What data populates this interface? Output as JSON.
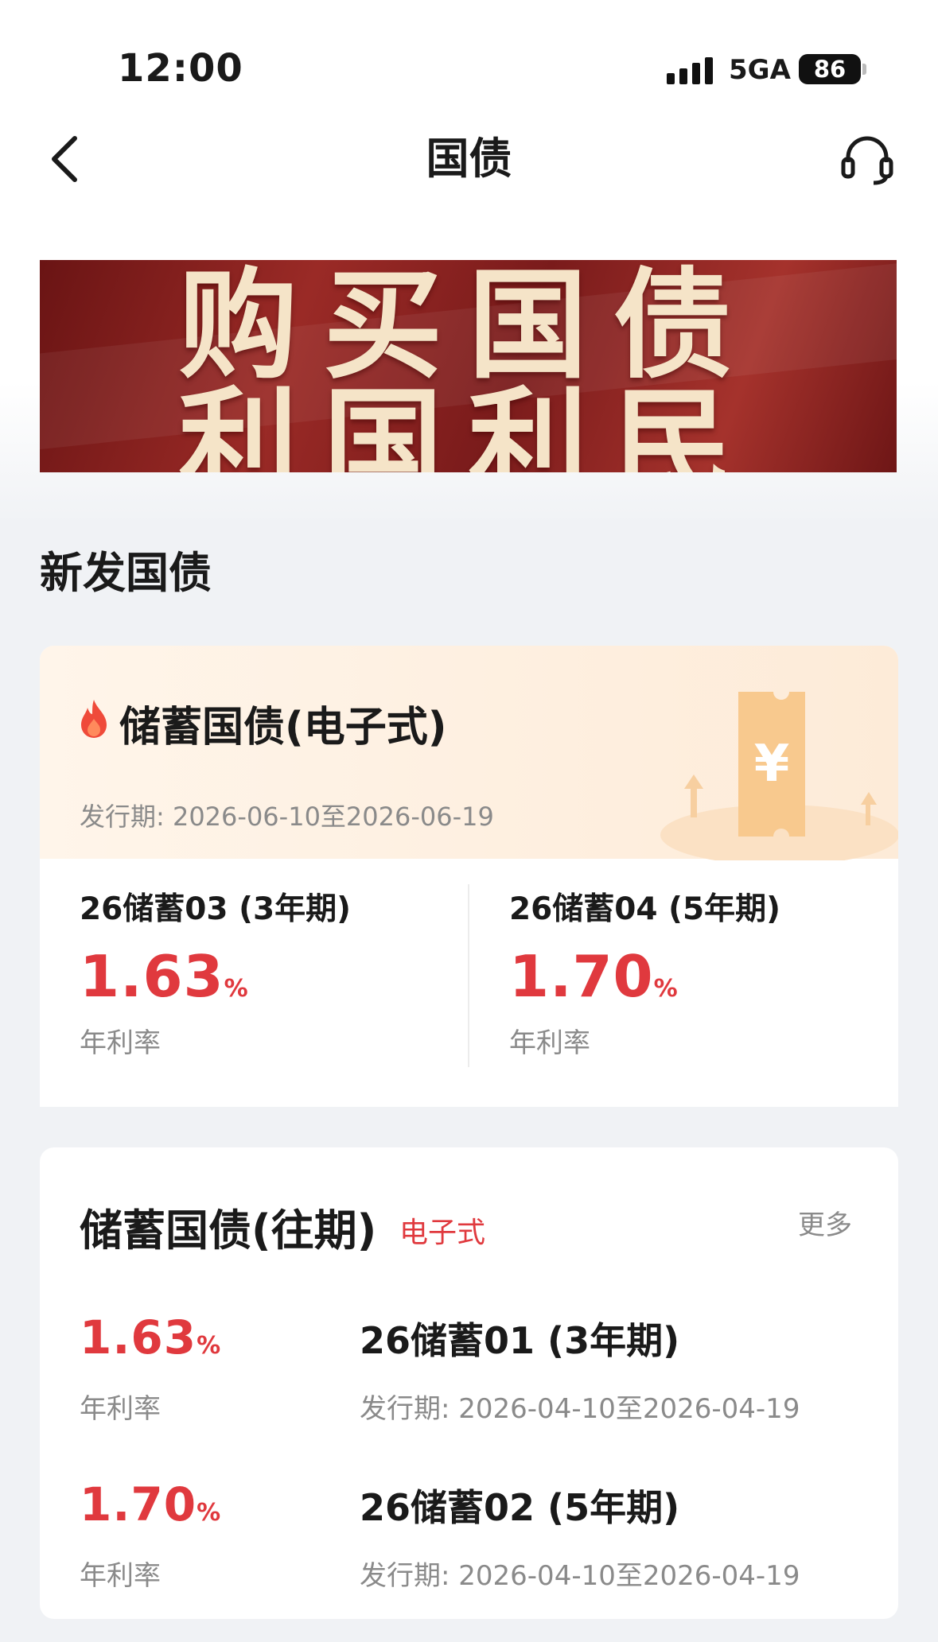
{
  "status_bar": {
    "time": "12:00",
    "network": "5GA",
    "battery": "86"
  },
  "nav": {
    "title": "国债"
  },
  "banner": {
    "line1": "购买国债",
    "line2": "利国利民"
  },
  "section_title": "新发国债",
  "new_issue": {
    "title": "储蓄国债(电子式)",
    "period": "发行期: 2026-06-10至2026-06-19",
    "bonds": [
      {
        "name": "26储蓄03 (3年期)",
        "rate": "1.63",
        "unit": "%",
        "rate_label": "年利率"
      },
      {
        "name": "26储蓄04 (5年期)",
        "rate": "1.70",
        "unit": "%",
        "rate_label": "年利率"
      }
    ]
  },
  "past": {
    "title": "储蓄国债(往期)",
    "tag": "电子式",
    "more": "更多",
    "items": [
      {
        "rate": "1.63",
        "unit": "%",
        "rate_label": "年利率",
        "name": "26储蓄01 (3年期)",
        "period": "发行期: 2026-04-10至2026-04-19"
      },
      {
        "rate": "1.70",
        "unit": "%",
        "rate_label": "年利率",
        "name": "26储蓄02 (5年期)",
        "period": "发行期: 2026-04-10至2026-04-19"
      }
    ]
  },
  "colors": {
    "accent_red": "#e0393e",
    "muted": "#8a8a8a",
    "page_bg": "#f0f2f5"
  },
  "icons": [
    "back-arrow-icon",
    "headset-icon",
    "fire-icon",
    "yuan-ticket-icon"
  ]
}
